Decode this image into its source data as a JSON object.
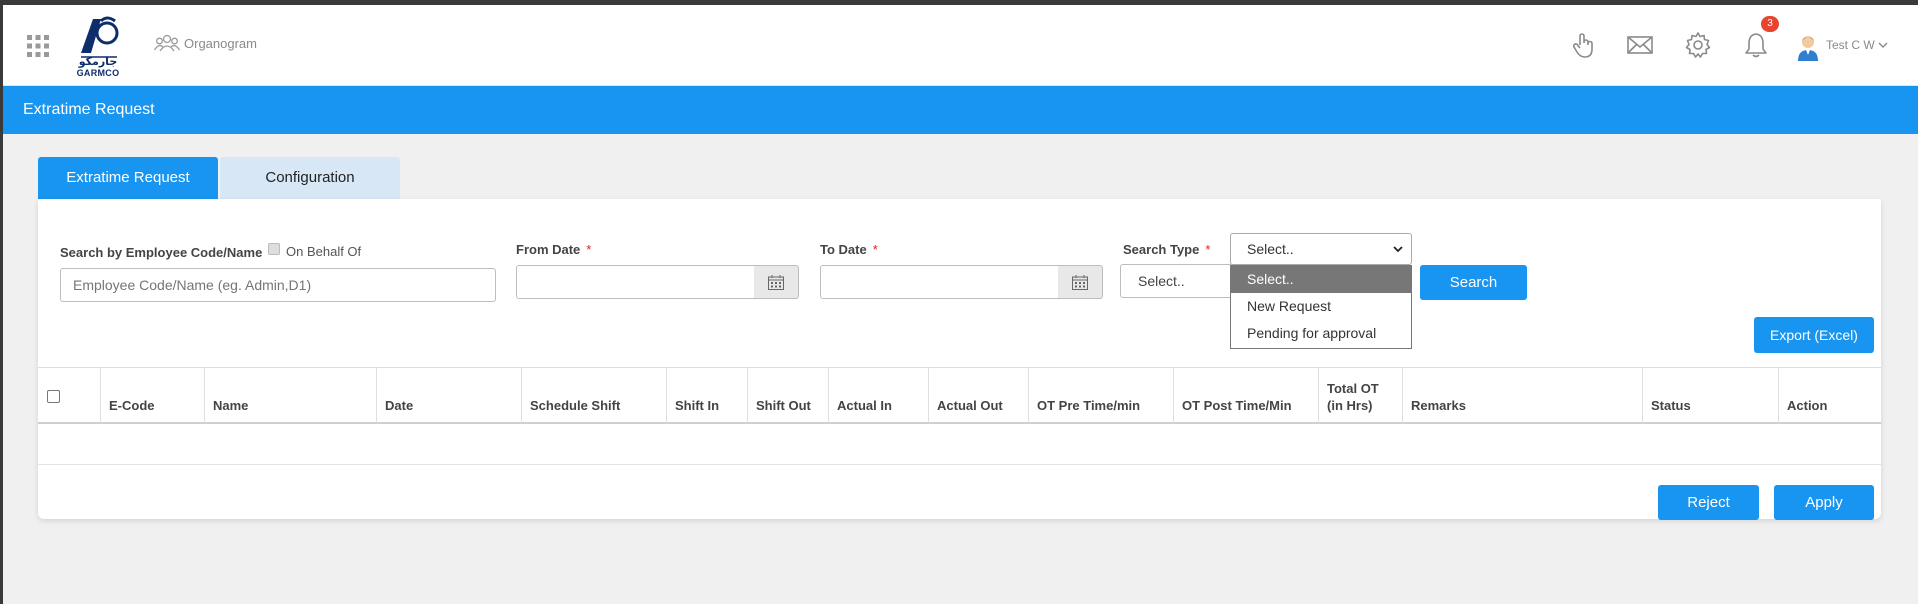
{
  "topbar": {
    "logo_text": "GARMCO",
    "logo_arabic": "جارمكو",
    "organogram_label": "Organogram",
    "icons": [
      "apps-grid-icon",
      "hand-pointer-icon",
      "mail-icon",
      "gear-icon",
      "bell-icon"
    ],
    "notification_count": "3",
    "user_name": "Test C W"
  },
  "page": {
    "title": "Extratime Request"
  },
  "tabs": [
    {
      "label": "Extratime Request",
      "active": true
    },
    {
      "label": "Configuration",
      "active": false
    }
  ],
  "filters": {
    "search_label": "Search by Employee Code/Name",
    "on_behalf_label": "On Behalf Of",
    "search_placeholder": "Employee Code/Name (eg. Admin,D1)",
    "from_date_label": "From Date",
    "to_date_label": "To Date",
    "required_marker": "*",
    "search_type_label": "Search Type",
    "search_type_secondary_value": "Select..",
    "search_type_value": "Select..",
    "search_type_options": [
      "Select..",
      "New Request",
      "Pending for approval"
    ],
    "search_button": "Search",
    "export_button": "Export (Excel)"
  },
  "table": {
    "columns": [
      "E-Code",
      "Name",
      "Date",
      "Schedule Shift",
      "Shift In",
      "Shift Out",
      "Actual In",
      "Actual Out",
      "OT Pre Time/min",
      "OT Post Time/Min",
      "Total OT (in Hrs)",
      "Remarks",
      "Status",
      "Action"
    ],
    "rows": []
  },
  "actions": {
    "reject_button": "Reject",
    "apply_button": "Apply"
  },
  "colors": {
    "primary": "#1795f0",
    "tab_inactive": "#d8e7f5",
    "badge": "#e8452e",
    "required": "#e02020"
  }
}
